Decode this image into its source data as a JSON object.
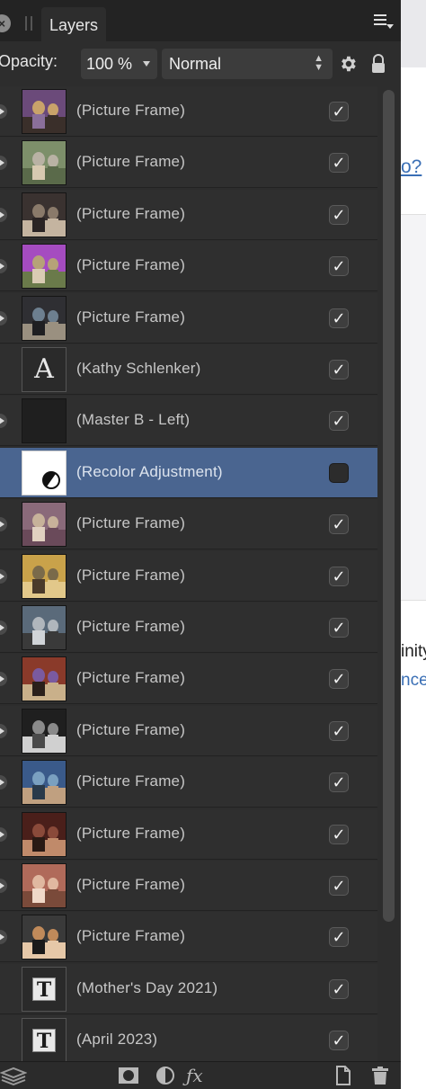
{
  "panel": {
    "tab_label": "Layers",
    "opacity_label": "Opacity:",
    "opacity_value": "100 %",
    "blend_mode": "Normal"
  },
  "background": {
    "link_fragment": "o?",
    "text_fragment": "inity",
    "link_fragment_2": "nce"
  },
  "layers": [
    {
      "label": "(Picture Frame)",
      "kind": "photo",
      "visible": true,
      "expandable": true,
      "palette": [
        "#6b4a7a",
        "#c9a36a",
        "#3a2f2a",
        "#8a6f9a"
      ]
    },
    {
      "label": "(Picture Frame)",
      "kind": "photo",
      "visible": true,
      "expandable": true,
      "palette": [
        "#7d8f6a",
        "#b9b2a4",
        "#5a6a4a",
        "#d7c9b0"
      ]
    },
    {
      "label": "(Picture Frame)",
      "kind": "photo",
      "visible": true,
      "expandable": true,
      "palette": [
        "#3a3230",
        "#8a7a6a",
        "#c4b4a0",
        "#2a2424"
      ]
    },
    {
      "label": "(Picture Frame)",
      "kind": "photo",
      "visible": true,
      "expandable": true,
      "palette": [
        "#a54cc0",
        "#b6a278",
        "#6a7a4a",
        "#d9cbb3"
      ]
    },
    {
      "label": "(Picture Frame)",
      "kind": "photo",
      "visible": true,
      "expandable": true,
      "palette": [
        "#2f2f33",
        "#6d7f8f",
        "#9a9080",
        "#1f1f22"
      ]
    },
    {
      "label": "(Kathy Schlenker)",
      "kind": "text-A",
      "visible": true,
      "expandable": false
    },
    {
      "label": "(Master B - Left)",
      "kind": "blank",
      "visible": true,
      "expandable": true
    },
    {
      "label": "(Recolor Adjustment)",
      "kind": "adjustment",
      "visible": false,
      "expandable": false,
      "selected": true
    },
    {
      "label": "(Picture Frame)",
      "kind": "photo",
      "visible": true,
      "expandable": true,
      "palette": [
        "#8a6a7a",
        "#c7b29a",
        "#6a4a5a",
        "#e0d0c0"
      ]
    },
    {
      "label": "(Picture Frame)",
      "kind": "photo",
      "visible": true,
      "expandable": true,
      "palette": [
        "#c9a24a",
        "#7a6a4a",
        "#e2c88a",
        "#4a3a2a"
      ]
    },
    {
      "label": "(Picture Frame)",
      "kind": "photo",
      "visible": true,
      "expandable": true,
      "palette": [
        "#5a6a7a",
        "#b0b6bc",
        "#3a3a3a",
        "#d0d4d8"
      ]
    },
    {
      "label": "(Picture Frame)",
      "kind": "photo",
      "visible": true,
      "expandable": true,
      "palette": [
        "#8a3a2a",
        "#7a5aa0",
        "#c9b08a",
        "#2a1f1a"
      ]
    },
    {
      "label": "(Picture Frame)",
      "kind": "photo",
      "visible": true,
      "expandable": true,
      "palette": [
        "#1f1f1f",
        "#8a8a8a",
        "#d0d0d0",
        "#4a4a4a"
      ]
    },
    {
      "label": "(Picture Frame)",
      "kind": "photo",
      "visible": true,
      "expandable": true,
      "palette": [
        "#3a5a8a",
        "#7aa0c0",
        "#c0a080",
        "#2a3a4a"
      ]
    },
    {
      "label": "(Picture Frame)",
      "kind": "photo",
      "visible": true,
      "expandable": true,
      "palette": [
        "#4a1f1a",
        "#8a4a3a",
        "#c08a6a",
        "#2a1a14"
      ]
    },
    {
      "label": "(Picture Frame)",
      "kind": "photo",
      "visible": true,
      "expandable": true,
      "palette": [
        "#b06a5a",
        "#e0b8a0",
        "#7a4a3a",
        "#f0d8c8"
      ]
    },
    {
      "label": "(Picture Frame)",
      "kind": "photo",
      "visible": true,
      "expandable": true,
      "palette": [
        "#3a3a3a",
        "#c08a5a",
        "#e6c8a8",
        "#1a1a1a"
      ]
    },
    {
      "label": "(Mother's Day 2021)",
      "kind": "text-T",
      "visible": true,
      "expandable": false
    },
    {
      "label": "(April 2023)",
      "kind": "text-T",
      "visible": true,
      "expandable": false
    }
  ],
  "colors": {
    "panel_bg": "#2d2d2d",
    "selected_row": "#4a6590",
    "label_text": "#c7c7c7",
    "link_blue": "#3a6fb5"
  }
}
